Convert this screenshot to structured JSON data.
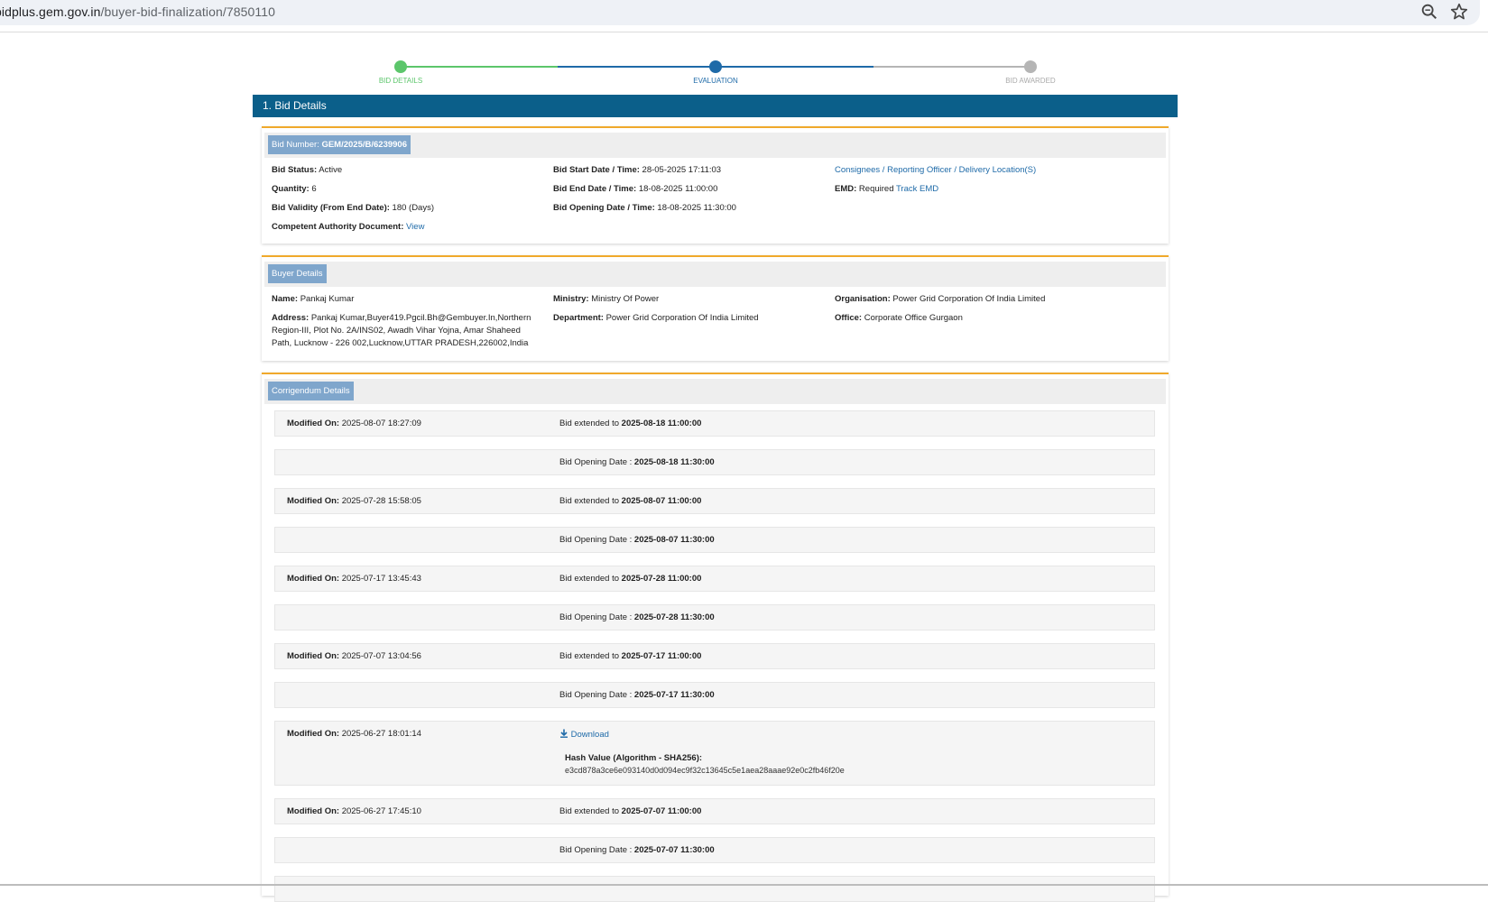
{
  "browser": {
    "url_domain": "bidplus.gem.gov.in",
    "url_path": "/buyer-bid-finalization/7850110",
    "zoom_icon": "zoom-icon",
    "star_icon": "star-icon"
  },
  "stepper": {
    "steps": [
      {
        "label": "BID DETAILS",
        "color": "#5cc66b",
        "state": "done"
      },
      {
        "label": "EVALUATION",
        "color": "#1e6aa8",
        "state": "current"
      },
      {
        "label": "BID AWARDED",
        "color": "#b5b5b5",
        "state": "pending"
      }
    ]
  },
  "section": {
    "title": "1. Bid Details"
  },
  "bid": {
    "badge_label": "Bid Number:",
    "badge_value": "GEM/2025/B/6239906",
    "status_label": "Bid Status:",
    "status_value": "Active",
    "quantity_label": "Quantity:",
    "quantity_value": "6",
    "validity_label": "Bid Validity (From End Date):",
    "validity_value": "180 (Days)",
    "authority_label": "Competent Authority Document:",
    "authority_link": "View",
    "start_label": "Bid Start Date / Time:",
    "start_value": "28-05-2025 17:11:03",
    "end_label": "Bid End Date / Time:",
    "end_value": "18-08-2025 11:00:00",
    "opening_label": "Bid Opening Date / Time:",
    "opening_value": "18-08-2025 11:30:00",
    "consignees_link": "Consignees / Reporting Officer / Delivery Location(S)",
    "emd_label": "EMD:",
    "emd_value": "Required",
    "emd_link": "Track EMD"
  },
  "buyer": {
    "badge_label": "Buyer Details",
    "name_label": "Name:",
    "name_value": "Pankaj Kumar",
    "address_label": "Address:",
    "address_value": "Pankaj Kumar,Buyer419.Pgcil.Bh@Gembuyer.In,Northern Region-III, Plot No. 2A/INS02, Awadh Vihar Yojna, Amar Shaheed Path, Lucknow - 226 002,Lucknow,UTTAR PRADESH,226002,India",
    "ministry_label": "Ministry:",
    "ministry_value": "Ministry Of Power",
    "department_label": "Department:",
    "department_value": "Power Grid Corporation Of India Limited",
    "organisation_label": "Organisation:",
    "organisation_value": "Power Grid Corporation Of India Limited",
    "office_label": "Office:",
    "office_value": "Corporate Office Gurgaon"
  },
  "corrigendum": {
    "badge_label": "Corrigendum Details",
    "modified_label": "Modified On:",
    "extended_label": "Bid extended to",
    "opening_label": "Bid Opening Date :",
    "rows": [
      {
        "modified": "2025-08-07 18:27:09",
        "extended": "2025-08-18 11:00:00",
        "opening": "2025-08-18 11:30:00"
      },
      {
        "modified": "2025-07-28 15:58:05",
        "extended": "2025-08-07 11:00:00",
        "opening": "2025-08-07 11:30:00"
      },
      {
        "modified": "2025-07-17 13:45:43",
        "extended": "2025-07-28 11:00:00",
        "opening": "2025-07-28 11:30:00"
      },
      {
        "modified": "2025-07-07 13:04:56",
        "extended": "2025-07-17 11:00:00",
        "opening": "2025-07-17 11:30:00"
      }
    ],
    "download_row": {
      "modified": "2025-06-27 18:01:14",
      "download_label": "Download",
      "hash_label": "Hash Value (Algorithm - SHA256):",
      "hash_value": "e3cd878a3ce6e093140d0d094ec9f32c13645c5e1aea28aaae92e0c2fb46f20e"
    },
    "last_row": {
      "modified": "2025-06-27 17:45:10",
      "extended": "2025-07-07 11:00:00",
      "opening": "2025-07-07 11:30:00"
    }
  }
}
